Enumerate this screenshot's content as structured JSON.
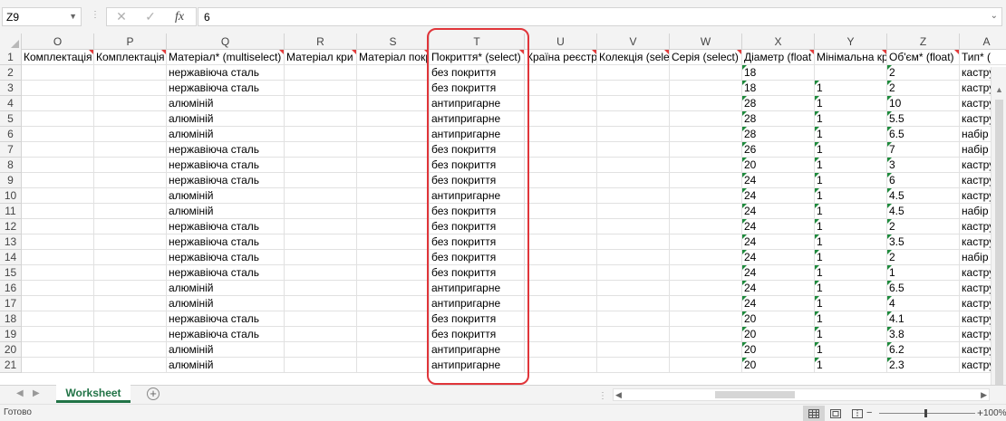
{
  "formula_bar": {
    "name_box": "Z9",
    "cancel_glyph": "✕",
    "enter_glyph": "✓",
    "fx_label": "fx",
    "value": "6"
  },
  "columns": [
    {
      "letter": "O",
      "header": "Комплектація"
    },
    {
      "letter": "P",
      "header": "Комплектація"
    },
    {
      "letter": "Q",
      "header": "Матеріал* (multiselect)"
    },
    {
      "letter": "R",
      "header": "Матеріал кри"
    },
    {
      "letter": "S",
      "header": "Матеріал покр"
    },
    {
      "letter": "T",
      "header": "Покриття* (select)"
    },
    {
      "letter": "U",
      "header": "Країна реєстр"
    },
    {
      "letter": "V",
      "header": "Колекція (sele"
    },
    {
      "letter": "W",
      "header": "Серія (select)"
    },
    {
      "letter": "X",
      "header": "Діаметр (float"
    },
    {
      "letter": "Y",
      "header": "Мінімальна кр"
    },
    {
      "letter": "Z",
      "header": "Об'єм* (float)"
    },
    {
      "letter": "A",
      "header": "Тип* ("
    }
  ],
  "row_numbers": [
    "1",
    "2",
    "3",
    "4",
    "5",
    "6",
    "7",
    "8",
    "9",
    "10",
    "11",
    "12",
    "13",
    "14",
    "15",
    "16",
    "17",
    "18",
    "19",
    "20",
    "21"
  ],
  "rows": [
    {
      "q": "нержавіюча сталь",
      "t": "без покриття",
      "x": "18",
      "y": "",
      "z": "2",
      "a": "кастру"
    },
    {
      "q": "нержавіюча сталь",
      "t": "без покриття",
      "x": "18",
      "y": "1",
      "z": "2",
      "a": "кастру"
    },
    {
      "q": "алюміній",
      "t": "антипригарне",
      "x": "28",
      "y": "1",
      "z": "10",
      "a": "кастру"
    },
    {
      "q": "алюміній",
      "t": "антипригарне",
      "x": "28",
      "y": "1",
      "z": "5.5",
      "a": "кастру"
    },
    {
      "q": "алюміній",
      "t": "антипригарне",
      "x": "28",
      "y": "1",
      "z": "6.5",
      "a": "набір"
    },
    {
      "q": "нержавіюча сталь",
      "t": "без покриття",
      "x": "26",
      "y": "1",
      "z": "7",
      "a": "набір"
    },
    {
      "q": "нержавіюча сталь",
      "t": "без покриття",
      "x": "20",
      "y": "1",
      "z": "3",
      "a": "кастру"
    },
    {
      "q": "нержавіюча сталь",
      "t": "без покриття",
      "x": "24",
      "y": "1",
      "z": "6",
      "a": "кастру"
    },
    {
      "q": "алюміній",
      "t": "антипригарне",
      "x": "24",
      "y": "1",
      "z": "4.5",
      "a": "кастру"
    },
    {
      "q": "алюміній",
      "t": "без покриття",
      "x": "24",
      "y": "1",
      "z": "4.5",
      "a": "набір"
    },
    {
      "q": "нержавіюча сталь",
      "t": "без покриття",
      "x": "24",
      "y": "1",
      "z": "2",
      "a": "кастру"
    },
    {
      "q": "нержавіюча сталь",
      "t": "без покриття",
      "x": "24",
      "y": "1",
      "z": "3.5",
      "a": "кастру"
    },
    {
      "q": "нержавіюча сталь",
      "t": "без покриття",
      "x": "24",
      "y": "1",
      "z": "2",
      "a": "набір"
    },
    {
      "q": "нержавіюча сталь",
      "t": "без покриття",
      "x": "24",
      "y": "1",
      "z": "1",
      "a": "кастру"
    },
    {
      "q": "алюміній",
      "t": "антипригарне",
      "x": "24",
      "y": "1",
      "z": "6.5",
      "a": "кастру"
    },
    {
      "q": "алюміній",
      "t": "антипригарне",
      "x": "24",
      "y": "1",
      "z": "4",
      "a": "кастру"
    },
    {
      "q": "нержавіюча сталь",
      "t": "без покриття",
      "x": "20",
      "y": "1",
      "z": "4.1",
      "a": "кастру"
    },
    {
      "q": "нержавіюча сталь",
      "t": "без покриття",
      "x": "20",
      "y": "1",
      "z": "3.8",
      "a": "кастру"
    },
    {
      "q": "алюміній",
      "t": "антипригарне",
      "x": "20",
      "y": "1",
      "z": "6.2",
      "a": "кастру"
    },
    {
      "q": "алюміній",
      "t": "антипригарне",
      "x": "20",
      "y": "1",
      "z": "2.3",
      "a": "кастру"
    }
  ],
  "sheet_tabs": {
    "active": "Worksheet",
    "add_glyph": "+"
  },
  "status_bar": {
    "status": "Готово",
    "zoom_minus": "−",
    "zoom_plus": "+",
    "zoom": "100%"
  },
  "colors": {
    "highlight": "#e0353a",
    "active_tab": "#217346",
    "comment_marker": "#e23b3b",
    "number_as_text_marker": "#1e8a3c"
  }
}
